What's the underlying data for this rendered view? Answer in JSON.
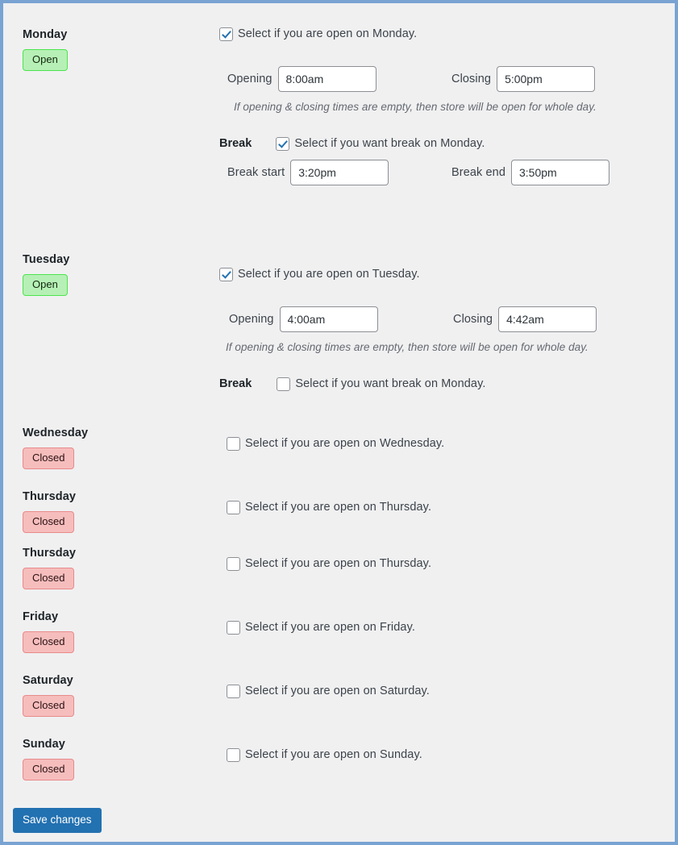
{
  "form": {
    "hint_text": "If opening & closing times are empty, then store will be open for whole day.",
    "break_title": "Break",
    "opening_label": "Opening",
    "closing_label": "Closing",
    "break_start_label": "Break start",
    "break_end_label": "Break end",
    "save_label": "Save changes",
    "status_open": "Open",
    "status_closed": "Closed"
  },
  "colors": {
    "frame_border": "#79a3d2",
    "page_background": "#f0f0f1",
    "open_badge_bg": "#b6f0b6",
    "open_badge_border": "#4ee44e",
    "closed_badge_bg": "#f6bdbd",
    "closed_badge_border": "#e98a8a",
    "checkbox_check": "#2271b1",
    "primary_button": "#2271b1"
  },
  "days": [
    {
      "name": "Monday",
      "status": "Open",
      "open_checkbox": {
        "checked": true,
        "label": "Select if you are open on Monday."
      },
      "times": {
        "opening_label": "Opening",
        "opening_value": "8:00am",
        "closing_label": "Closing",
        "closing_value": "5:00pm"
      },
      "hint": "If opening & closing times are empty, then store will be open for whole day.",
      "break": {
        "title": "Break",
        "checkbox": {
          "checked": true,
          "label": "Select if you want break on Monday."
        },
        "start_label": "Break start",
        "start_value": "3:20pm",
        "end_label": "Break end",
        "end_value": "3:50pm"
      }
    },
    {
      "name": "Tuesday",
      "status": "Open",
      "open_checkbox": {
        "checked": true,
        "label": "Select if you are open on Tuesday."
      },
      "times": {
        "opening_label": "Opening",
        "opening_value": "4:00am",
        "closing_label": "Closing",
        "closing_value": "4:42am"
      },
      "hint": "If opening & closing times are empty, then store will be open for whole day.",
      "break": {
        "title": "Break",
        "checkbox": {
          "checked": false,
          "label": "Select if you want break on Monday."
        }
      }
    },
    {
      "name": "Wednesday",
      "status": "Closed",
      "open_checkbox": {
        "checked": false,
        "label": "Select if you are open on Wednesday."
      }
    },
    {
      "name": "Thursday",
      "status": "Closed",
      "open_checkbox": {
        "checked": false,
        "label": "Select if you are open on Thursday."
      }
    },
    {
      "name": "Thursday",
      "status": "Closed",
      "open_checkbox": {
        "checked": false,
        "label": "Select if you are open on Thursday."
      }
    },
    {
      "name": "Friday",
      "status": "Closed",
      "open_checkbox": {
        "checked": false,
        "label": "Select if you are open on Friday."
      }
    },
    {
      "name": "Saturday",
      "status": "Closed",
      "open_checkbox": {
        "checked": false,
        "label": "Select if you are open on Saturday."
      }
    },
    {
      "name": "Sunday",
      "status": "Closed",
      "open_checkbox": {
        "checked": false,
        "label": "Select if you are open on Sunday."
      }
    }
  ]
}
